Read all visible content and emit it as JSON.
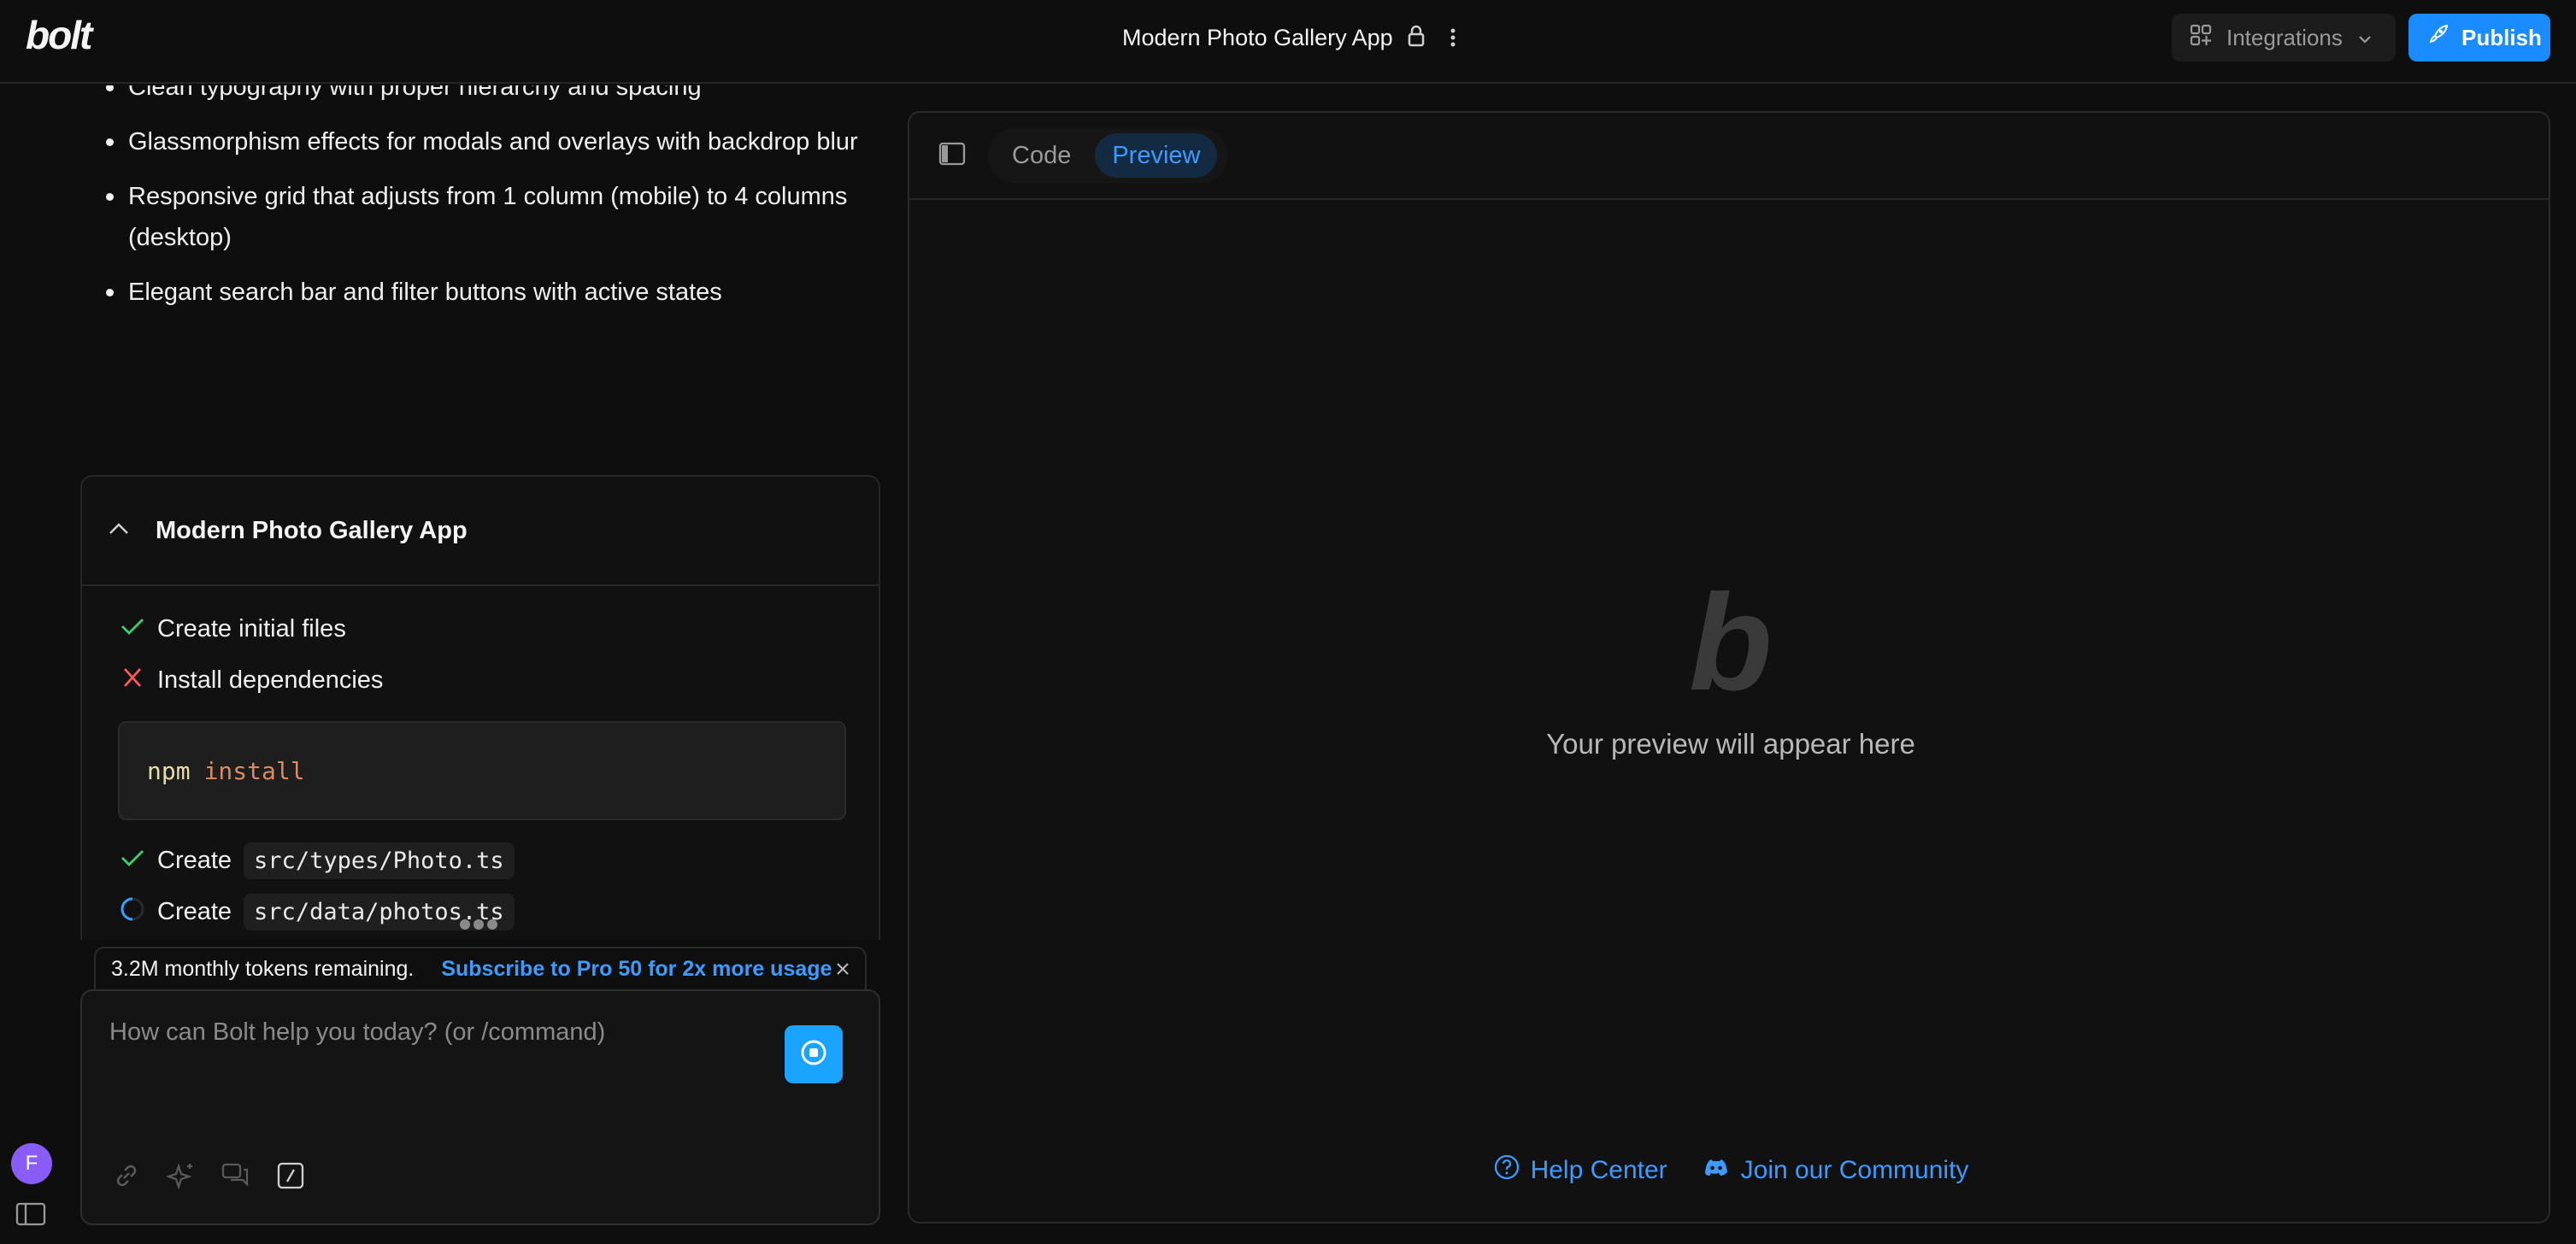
{
  "app": {
    "logo": "bolt"
  },
  "header": {
    "project_title": "Modern Photo Gallery App",
    "integrations_label": "Integrations",
    "publish_label": "Publish"
  },
  "chat": {
    "bullets": [
      "Clean typography with proper hierarchy and spacing",
      "Glassmorphism effects for modals and overlays with backdrop blur",
      "Responsive grid that adjusts from 1 column (mobile) to 4 columns (desktop)",
      "Elegant search bar and filter buttons with active states"
    ],
    "artifact": {
      "title": "Modern Photo Gallery App",
      "steps": [
        {
          "status": "done",
          "label": "Create initial files"
        },
        {
          "status": "failed",
          "label": "Install dependencies"
        },
        {
          "status": "done",
          "label": "Create",
          "file": "src/types/Photo.ts"
        },
        {
          "status": "running",
          "label": "Create",
          "file": "src/data/photos.ts"
        }
      ],
      "command": {
        "cmd": "npm",
        "arg": "install"
      }
    },
    "tokens_banner": {
      "text": "3.2M monthly tokens remaining.",
      "link": "Subscribe to Pro 50 for 2x more usage"
    },
    "prompt": {
      "placeholder": "How can Bolt help you today? (or /command)",
      "value": ""
    },
    "user_initial": "F"
  },
  "workbench": {
    "tabs": {
      "code": "Code",
      "preview": "Preview",
      "active": "preview"
    },
    "preview_logo": "b",
    "preview_message": "Your preview will appear here",
    "links": {
      "help": "Help Center",
      "community": "Join our Community"
    }
  },
  "colors": {
    "accent": "#1a8cff",
    "link": "#3d9bff",
    "success": "#3ccf6e",
    "error": "#ff5a5a",
    "background": "#0e0e0e"
  }
}
